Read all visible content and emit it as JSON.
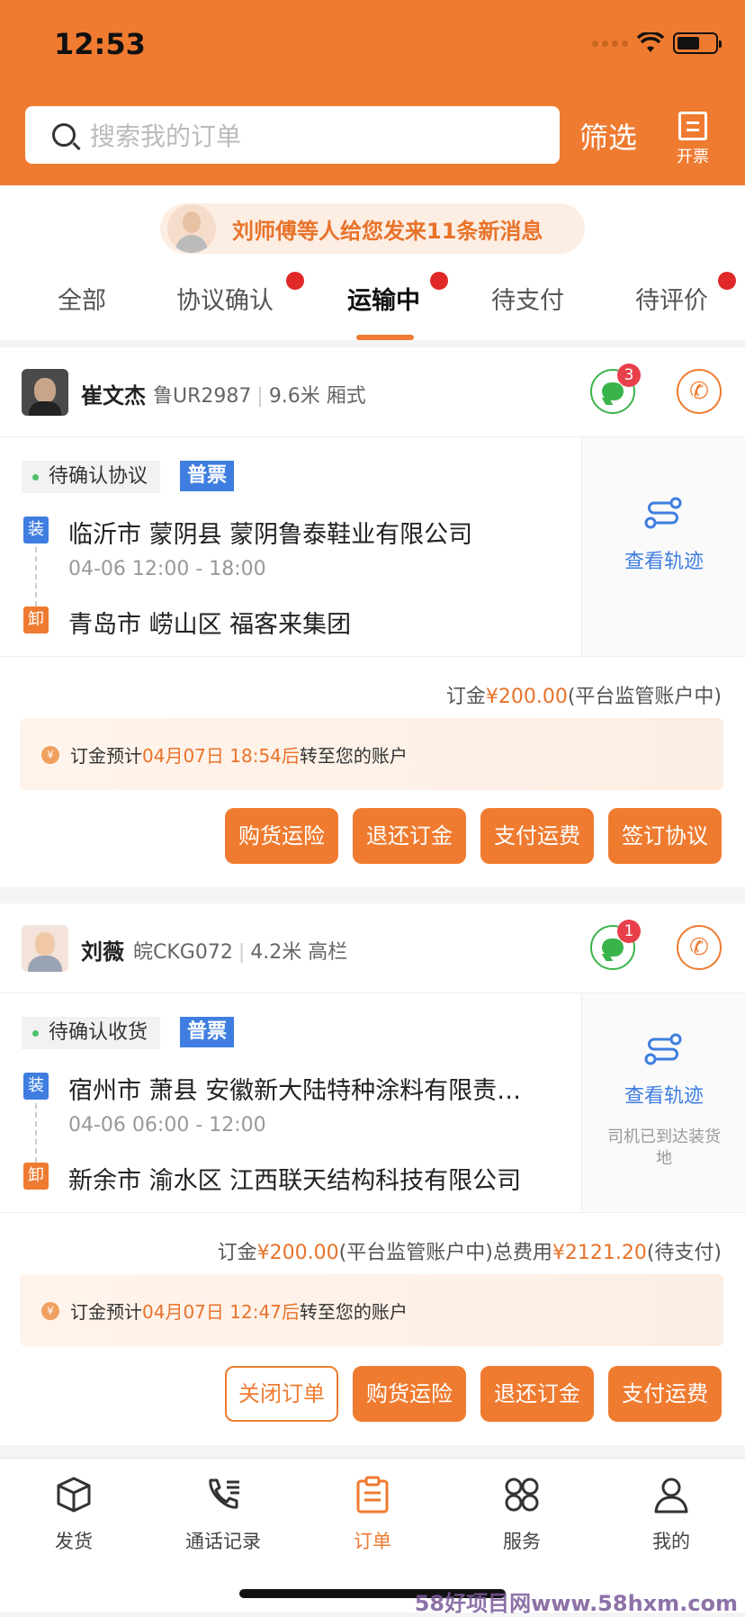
{
  "status_bar": {
    "time": "12:53"
  },
  "header": {
    "search_placeholder": "搜索我的订单",
    "filter_label": "筛选",
    "invoice_label": "开票"
  },
  "notice": {
    "text": "刘师傅等人给您发来11条新消息"
  },
  "tabs": [
    {
      "label": "全部",
      "dot": false
    },
    {
      "label": "协议确认",
      "dot": true
    },
    {
      "label": "运输中",
      "dot": true,
      "active": true
    },
    {
      "label": "待支付",
      "dot": false
    },
    {
      "label": "待评价",
      "dot": true
    }
  ],
  "orders": [
    {
      "driver_name": "崔文杰",
      "plate": "鲁UR2987",
      "truck": "9.6米 厢式",
      "chat_badge": "3",
      "status": "待确认协议",
      "ticket": "普票",
      "load_icon": "装",
      "unload_icon": "卸",
      "from": "临沂市 蒙阴县 蒙阴鲁泰鞋业有限公司",
      "time": "04-06 12:00 - 18:00",
      "to": "青岛市 崂山区 福客来集团",
      "track_label": "查看轨迹",
      "track_note": "",
      "deposit_prefix": "订金",
      "deposit_amount": "¥200.00",
      "deposit_suffix": "(平台监管账户中)",
      "total_prefix": "",
      "total_amount": "",
      "total_suffix": "",
      "eta_prefix": "订金预计",
      "eta_time": "04月07日 18:54后",
      "eta_suffix": "转至您的账户",
      "buttons": [
        {
          "label": "购货运险",
          "style": "solid"
        },
        {
          "label": "退还订金",
          "style": "solid"
        },
        {
          "label": "支付运费",
          "style": "solid"
        },
        {
          "label": "签订协议",
          "style": "solid"
        }
      ]
    },
    {
      "driver_name": "刘薇",
      "plate": "皖CKG072",
      "truck": "4.2米 高栏",
      "chat_badge": "1",
      "status": "待确认收货",
      "ticket": "普票",
      "load_icon": "装",
      "unload_icon": "卸",
      "from": "宿州市 萧县 安徽新大陆特种涂料有限责…",
      "time": "04-06 06:00 - 12:00",
      "to": "新余市 渝水区 江西联天结构科技有限公司",
      "track_label": "查看轨迹",
      "track_note": "司机已到达装货地",
      "deposit_prefix": "订金",
      "deposit_amount": "¥200.00",
      "deposit_suffix": "(平台监管账户中)",
      "total_prefix": "总费用",
      "total_amount": "¥2121.20",
      "total_suffix": "(待支付)",
      "eta_prefix": "订金预计",
      "eta_time": "04月07日 12:47后",
      "eta_suffix": "转至您的账户",
      "buttons": [
        {
          "label": "关闭订单",
          "style": "outline"
        },
        {
          "label": "购货运险",
          "style": "solid"
        },
        {
          "label": "退还订金",
          "style": "solid"
        },
        {
          "label": "支付运费",
          "style": "solid"
        }
      ]
    }
  ],
  "tabbar": [
    {
      "label": "发货",
      "icon": "box-icon"
    },
    {
      "label": "通话记录",
      "icon": "phone-list-icon"
    },
    {
      "label": "订单",
      "icon": "order-icon",
      "active": true
    },
    {
      "label": "服务",
      "icon": "grid-icon"
    },
    {
      "label": "我的",
      "icon": "user-icon"
    }
  ],
  "watermark": "58好项目网www.58hxm.com",
  "colors": {
    "brand": "#ef7b30",
    "blue": "#3f7ee0",
    "badge": "#e8404a"
  }
}
